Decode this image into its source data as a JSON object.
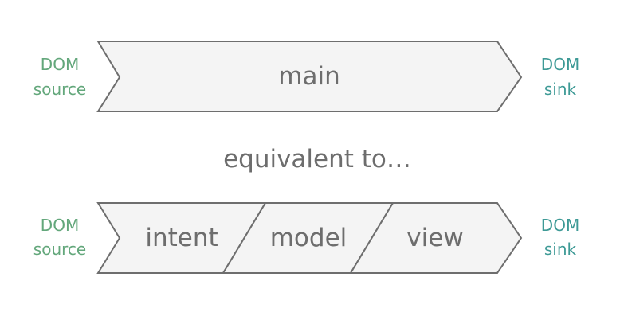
{
  "top_row": {
    "left_label": {
      "line1": "DOM",
      "line2": "source"
    },
    "main_label": "main",
    "right_label": {
      "line1": "DOM",
      "line2": "sink"
    }
  },
  "middle": {
    "equivalence_label": "equivalent to…"
  },
  "bottom_row": {
    "left_label": {
      "line1": "DOM",
      "line2": "source"
    },
    "segments": [
      "intent",
      "model",
      "view"
    ],
    "right_label": {
      "line1": "DOM",
      "line2": "sink"
    }
  },
  "colors": {
    "source_text": "#63a77b",
    "sink_text": "#3e9a96",
    "shape_fill": "#f4f4f4",
    "shape_stroke": "#6e6e6e",
    "main_text": "#6d6d6d"
  }
}
